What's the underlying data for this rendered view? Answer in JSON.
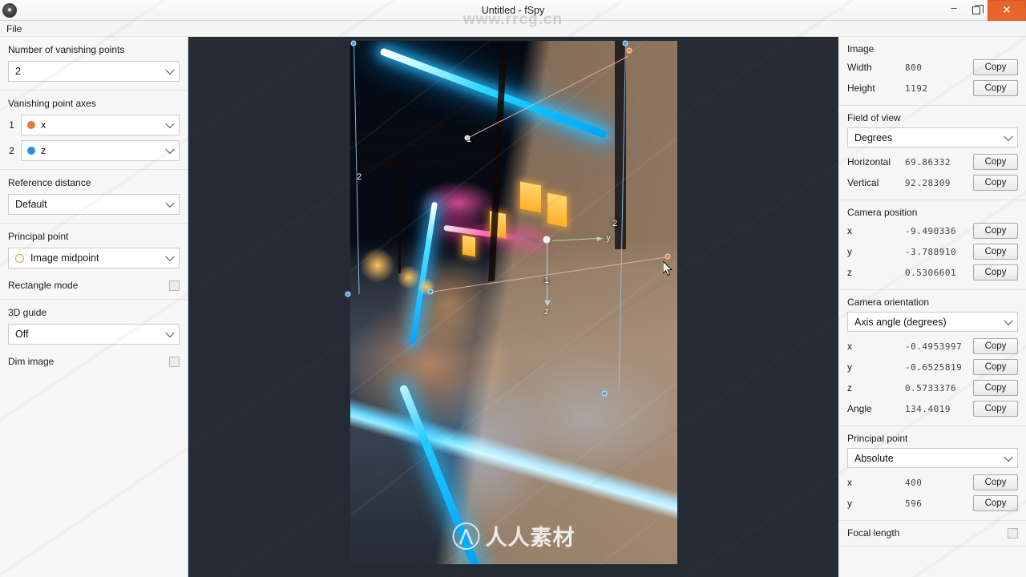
{
  "window": {
    "title": "Untitled - fSpy",
    "app_icon": "app-logo-icon",
    "minimize_label": "–",
    "maximize_label": "❐",
    "close_label": "✕",
    "accent_close_color": "#e8642d"
  },
  "menubar": {
    "items": [
      {
        "label": "File"
      }
    ]
  },
  "watermark": {
    "url": "www.rrcg.cn",
    "logo_text": "人人素材"
  },
  "left_panel": {
    "vanishing_points": {
      "title": "Number of vanishing points",
      "value": "2"
    },
    "axes": {
      "title": "Vanishing point axes",
      "rows": [
        {
          "index": "1",
          "color": "#e8793a",
          "value": "x"
        },
        {
          "index": "2",
          "color": "#2b8fe0",
          "value": "z"
        }
      ]
    },
    "reference_distance": {
      "title": "Reference distance",
      "value": "Default"
    },
    "principal_point": {
      "title": "Principal point",
      "value": "Image midpoint",
      "marker_color": "#d9a441"
    },
    "rectangle_mode": {
      "label": "Rectangle mode",
      "checked": false
    },
    "guide_3d": {
      "title": "3D guide",
      "value": "Off"
    },
    "dim_image": {
      "label": "Dim image",
      "checked": false
    }
  },
  "right_panel": {
    "copy_label": "Copy",
    "image": {
      "title": "Image",
      "rows": [
        {
          "label": "Width",
          "value": "800"
        },
        {
          "label": "Height",
          "value": "1192"
        }
      ]
    },
    "field_of_view": {
      "title": "Field of view",
      "unit": "Degrees",
      "rows": [
        {
          "label": "Horizontal",
          "value": "69.86332"
        },
        {
          "label": "Vertical",
          "value": "92.28309"
        }
      ]
    },
    "camera_position": {
      "title": "Camera position",
      "rows": [
        {
          "label": "x",
          "value": "-9.490336"
        },
        {
          "label": "y",
          "value": "-3.788910"
        },
        {
          "label": "z",
          "value": "0.5306601"
        }
      ]
    },
    "camera_orientation": {
      "title": "Camera orientation",
      "unit": "Axis angle (degrees)",
      "rows": [
        {
          "label": "x",
          "value": "-0.4953997"
        },
        {
          "label": "y",
          "value": "-0.6525819"
        },
        {
          "label": "z",
          "value": "0.5733376"
        },
        {
          "label": "Angle",
          "value": "134.4019"
        }
      ]
    },
    "principal_point": {
      "title": "Principal point",
      "unit": "Absolute",
      "rows": [
        {
          "label": "x",
          "value": "400"
        },
        {
          "label": "y",
          "value": "596"
        }
      ]
    },
    "focal_length": {
      "label": "Focal length",
      "checked": false
    }
  },
  "canvas": {
    "background_color": "#242b34",
    "overlay": {
      "vp1_labels": [
        "1",
        "1"
      ],
      "vp2_labels": [
        "2",
        "2"
      ],
      "axis_labels": [
        "y",
        "z"
      ]
    }
  }
}
